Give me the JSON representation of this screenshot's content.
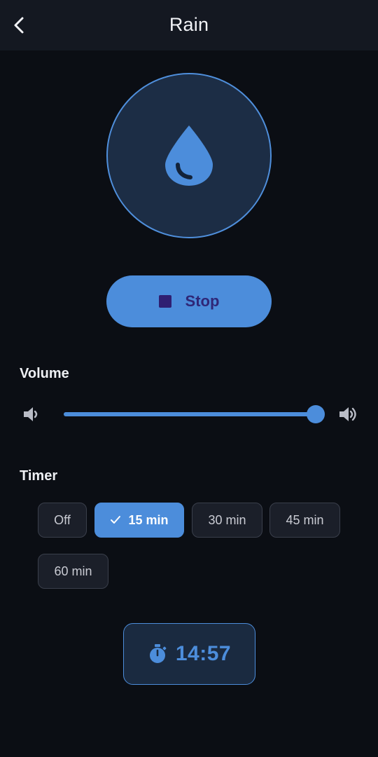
{
  "header": {
    "title": "Rain",
    "back_icon": "chevron-left-icon"
  },
  "sound": {
    "icon": "water-drop-icon",
    "playing": true
  },
  "stop_button": {
    "label": "Stop",
    "icon": "stop-icon"
  },
  "volume": {
    "label": "Volume",
    "level": 1.0,
    "min_icon": "volume-low-icon",
    "max_icon": "volume-high-icon"
  },
  "timer": {
    "label": "Timer",
    "options": [
      {
        "label": "Off",
        "selected": false
      },
      {
        "label": "15 min",
        "selected": true
      },
      {
        "label": "30 min",
        "selected": false
      },
      {
        "label": "45 min",
        "selected": false
      },
      {
        "label": "60 min",
        "selected": false
      }
    ],
    "selected_icon": "check-icon",
    "remaining": "14:57",
    "remaining_icon": "stopwatch-icon"
  },
  "colors": {
    "background": "#0b0e14",
    "appbar": "#141821",
    "accent": "#4c8ddb",
    "disc_fill": "#1c2d45",
    "stop_label": "#2f2777"
  }
}
